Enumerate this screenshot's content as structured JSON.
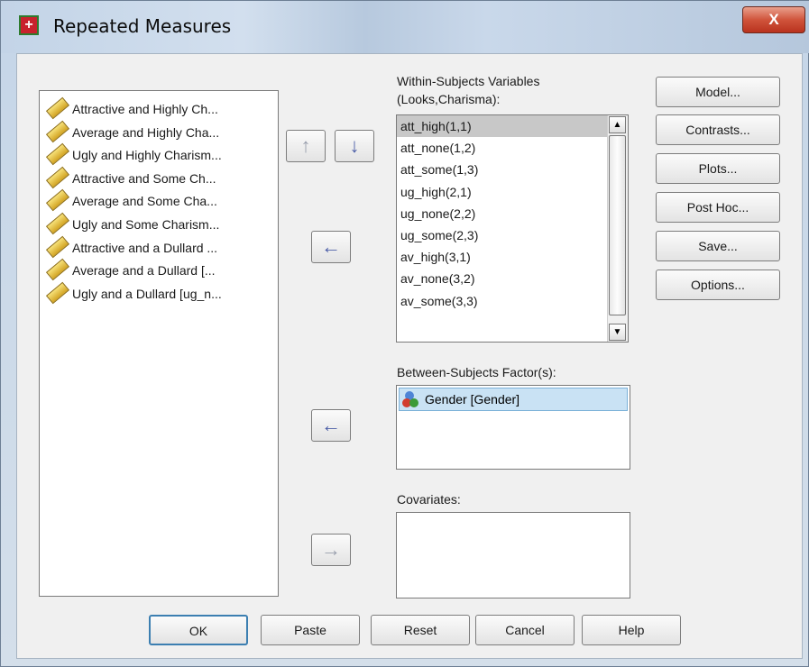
{
  "window": {
    "title": "Repeated Measures",
    "close_label": "X"
  },
  "source_list": {
    "items": [
      "Attractive and Highly Ch...",
      "Average and Highly Cha...",
      "Ugly and Highly Charism...",
      "Attractive and Some Ch...",
      "Average and Some Cha...",
      "Ugly and Some Charism...",
      "Attractive and a Dullard ...",
      "Average and a Dullard [...",
      "Ugly and a Dullard [ug_n..."
    ]
  },
  "within": {
    "label_line1": "Within-Subjects Variables",
    "label_line2": "(Looks,Charisma):",
    "items": [
      "att_high(1,1)",
      "att_none(1,2)",
      "att_some(1,3)",
      "ug_high(2,1)",
      "ug_none(2,2)",
      "ug_some(2,3)",
      "av_high(3,1)",
      "av_none(3,2)",
      "av_some(3,3)"
    ],
    "selected_index": 0
  },
  "between": {
    "label": "Between-Subjects Factor(s):",
    "items": [
      "Gender [Gender]"
    ]
  },
  "covariates": {
    "label": "Covariates:"
  },
  "side_buttons": [
    "Model...",
    "Contrasts...",
    "Plots...",
    "Post Hoc...",
    "Save...",
    "Options..."
  ],
  "bottom_buttons": [
    "OK",
    "Paste",
    "Reset",
    "Cancel",
    "Help"
  ],
  "icons": {
    "app": "spss-app-icon",
    "variable": "scale-ruler-icon",
    "factor": "nominal-balls-icon",
    "arrows": [
      "move-up-arrow-icon",
      "move-down-arrow-icon",
      "transfer-left-arrow-icon",
      "transfer-left-arrow-icon",
      "transfer-right-arrow-icon"
    ]
  }
}
